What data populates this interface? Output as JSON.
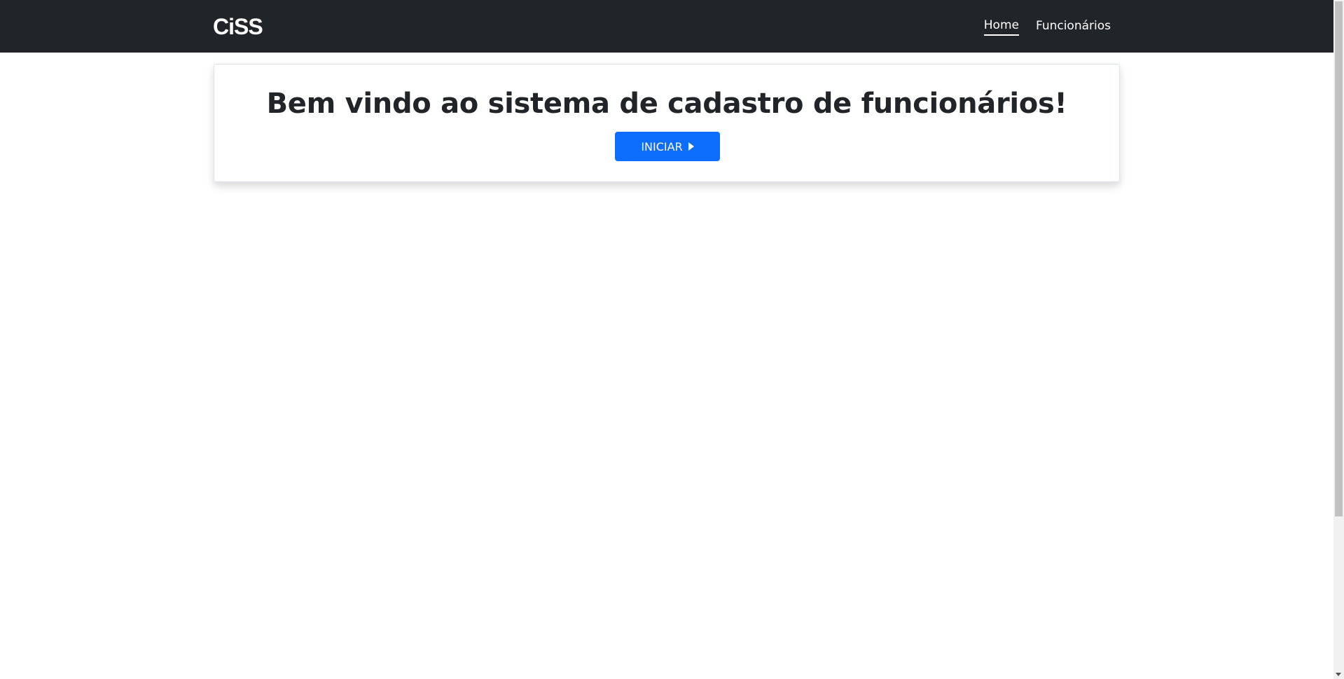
{
  "header": {
    "logo_text": "CiSS",
    "nav": [
      {
        "label": "Home",
        "active": true
      },
      {
        "label": "Funcionários",
        "active": false
      }
    ]
  },
  "main": {
    "title": "Bem vindo ao sistema de cadastro de funcionários!",
    "start_button": {
      "label": "INICIAR",
      "icon": "play-icon"
    }
  },
  "colors": {
    "navbar_bg": "#212529",
    "primary": "#0d6efd"
  }
}
